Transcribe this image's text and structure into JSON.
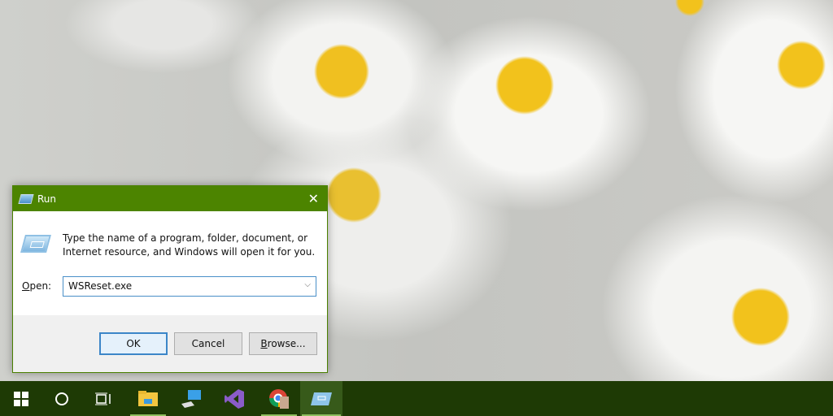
{
  "dialog": {
    "title": "Run",
    "message": "Type the name of a program, folder, document, or Internet resource, and Windows will open it for you.",
    "open_label_u": "O",
    "open_label_rest": "pen:",
    "open_value": "WSReset.exe",
    "ok": "OK",
    "cancel": "Cancel",
    "browse_u": "B",
    "browse_rest": "rowse..."
  },
  "taskbar": {
    "icons": [
      "windows-start-icon",
      "cortana-search-icon",
      "task-view-icon",
      "file-explorer-icon",
      "this-pc-icon",
      "visual-studio-icon",
      "chrome-icon",
      "run-icon"
    ]
  },
  "colors": {
    "accent": "#4c8400",
    "taskbar": "#1e3a05"
  }
}
